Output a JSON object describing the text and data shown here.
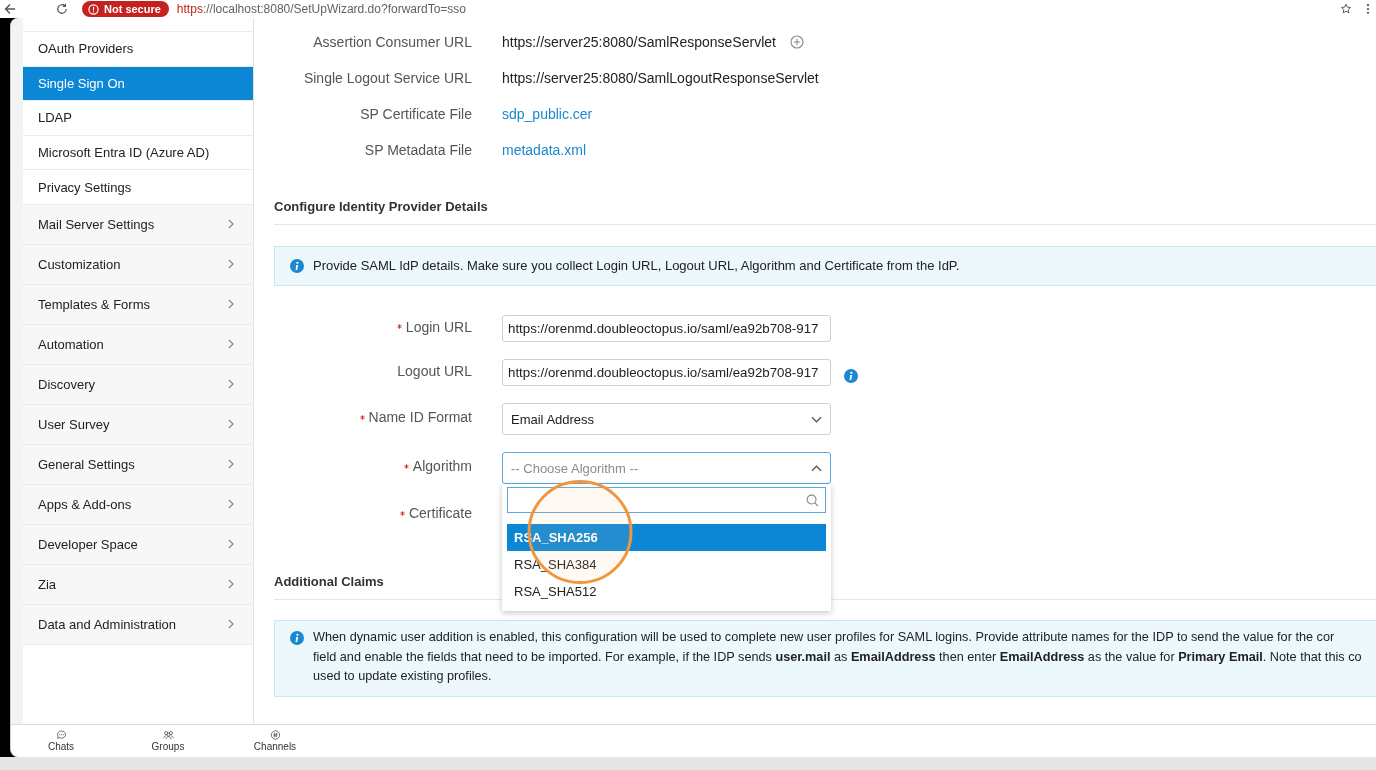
{
  "browser": {
    "security_label": "Not secure",
    "url_scheme": "https",
    "url_rest": "://localhost:8080/SetUpWizard.do?forwardTo=sso"
  },
  "sidebar": {
    "items": [
      {
        "label": "OAuth Providers",
        "kind": "link",
        "selected": false
      },
      {
        "label": "Single Sign On",
        "kind": "link",
        "selected": true
      },
      {
        "label": "LDAP",
        "kind": "link",
        "selected": false
      },
      {
        "label": "Microsoft Entra ID (Azure AD)",
        "kind": "link",
        "selected": false
      },
      {
        "label": "Privacy Settings",
        "kind": "link",
        "selected": false
      },
      {
        "label": "Mail Server Settings",
        "kind": "group",
        "selected": false
      },
      {
        "label": "Customization",
        "kind": "group",
        "selected": false
      },
      {
        "label": "Templates & Forms",
        "kind": "group",
        "selected": false
      },
      {
        "label": "Automation",
        "kind": "group",
        "selected": false
      },
      {
        "label": "Discovery",
        "kind": "group",
        "selected": false
      },
      {
        "label": "User Survey",
        "kind": "group",
        "selected": false
      },
      {
        "label": "General Settings",
        "kind": "group",
        "selected": false
      },
      {
        "label": "Apps & Add-ons",
        "kind": "group",
        "selected": false
      },
      {
        "label": "Developer Space",
        "kind": "group",
        "selected": false
      },
      {
        "label": "Zia",
        "kind": "group",
        "selected": false
      },
      {
        "label": "Data and Administration",
        "kind": "group",
        "selected": false
      }
    ]
  },
  "sp_details": {
    "rows": [
      {
        "label": "Assertion Consumer URL",
        "value": "https://server25:8080/SamlResponseServlet",
        "kind": "text",
        "add_button": true
      },
      {
        "label": "Single Logout Service URL",
        "value": "https://server25:8080/SamlLogoutResponseServlet",
        "kind": "text",
        "add_button": false
      },
      {
        "label": "SP Certificate File",
        "value": "sdp_public.cer",
        "kind": "link",
        "add_button": false
      },
      {
        "label": "SP Metadata File",
        "value": "metadata.xml",
        "kind": "link",
        "add_button": false
      }
    ]
  },
  "idp": {
    "title": "Configure Identity Provider Details",
    "info": "Provide SAML IdP details. Make sure you collect Login URL, Logout URL, Algorithm and Certificate from the IdP.",
    "fields": [
      {
        "label": "Login URL",
        "required": true,
        "kind": "input",
        "value": "https://orenmd.doubleoctopus.io/saml/ea92b708-917",
        "info": false
      },
      {
        "label": "Logout URL",
        "required": false,
        "kind": "input",
        "value": "https://orenmd.doubleoctopus.io/saml/ea92b708-917",
        "info": true
      },
      {
        "label": "Name ID Format",
        "required": true,
        "kind": "select",
        "value": "Email Address",
        "expanded": false
      },
      {
        "label": "Algorithm",
        "required": true,
        "kind": "select",
        "placeholder": "-- Choose Algorithm --",
        "expanded": true,
        "options": [
          {
            "label": "RSA_SHA256",
            "selected": true
          },
          {
            "label": "RSA_SHA384",
            "selected": false
          },
          {
            "label": "RSA_SHA512",
            "selected": false
          }
        ]
      },
      {
        "label": "Certificate",
        "required": true,
        "kind": "label"
      }
    ]
  },
  "annotations": [
    {
      "kind": "circle"
    }
  ],
  "claims": {
    "title": "Additional Claims",
    "info": "When dynamic user addition is enabled, this configuration will be used to complete new user profiles for SAML logins. Provide attribute names for the IDP to send the value for the cor\nfield and enable the fields that need to be imported. For example, if the IDP sends **user.mail** as **EmailAddress** then enter **EmailAddress** as the value for **Primary Email**. Note that this co\nused to update existing profiles."
  },
  "bottom_bar": {
    "items": [
      {
        "label": "Chats",
        "kind": "chats"
      },
      {
        "label": "Groups",
        "kind": "groups"
      },
      {
        "label": "Channels",
        "kind": "channels"
      }
    ]
  }
}
